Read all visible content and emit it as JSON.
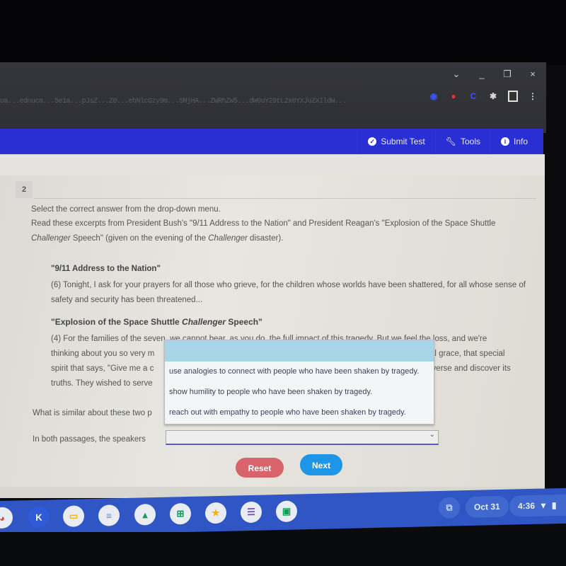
{
  "window": {
    "controls": {
      "dropdown": "⌄",
      "minimize": "_",
      "restore": "❐",
      "close": "×"
    },
    "address_bar_text": "ua...ednucm...5e1a...pJsZ...Z0...ehNlcGzy9m...SMjHA...ZWRhZW5...dW0uY29tL2x0YXJuZXIldW..."
  },
  "extensions": [
    {
      "name": "extension-blue-icon",
      "glyph": "◉"
    },
    {
      "name": "extension-red-icon",
      "glyph": "●"
    },
    {
      "name": "extension-c-icon",
      "glyph": "C"
    },
    {
      "name": "extensions-puzzle-icon",
      "glyph": "✱"
    },
    {
      "name": "side-panel-icon",
      "glyph": ""
    },
    {
      "name": "browser-menu-icon",
      "glyph": "⋮"
    }
  ],
  "toolbar": {
    "submit_label": "Submit Test",
    "tools_label": "Tools",
    "info_label": "Info"
  },
  "question": {
    "number": "2",
    "instruction": "Select the correct answer from the drop-down menu.",
    "intro_parts": [
      "Read these excerpts from President Bush's \"9/11 Address to the Nation\" and President Reagan's \"Explosion of the Space Shuttle ",
      "Challenger",
      " Speech\" (given on the evening of the ",
      "Challenger",
      " disaster)."
    ],
    "excerpt1_title": "\"9/11 Address to the Nation\"",
    "excerpt1_text": "(6) Tonight, I ask for your prayers for all those who grieve, for the children whose worlds have been shattered, for all whose sense of safety and security has been threatened...",
    "excerpt2_title_parts": [
      "\"Explosion of the Space Shuttle ",
      "Challenger",
      " Speech\""
    ],
    "excerpt2_lines": [
      "(4) For the families of the seven, we cannot bear, as you do, the full impact of this tragedy. But we feel the loss, and we're",
      "thinking about you so very m",
      "spirit that says, \"Give me a c",
      "truths. They wished to serve"
    ],
    "excerpt2_visible_right": [
      "al grace, that special",
      "iverse and discover its"
    ],
    "prompt": "What is similar about these two p",
    "answer_lead": "In both passages, the speakers",
    "dropdown": {
      "selected": "",
      "options": [
        "use analogies to connect with people who have been shaken by tragedy.",
        "show humility to people who have been shaken by tragedy.",
        "reach out with empathy to people who have been shaken by tragedy."
      ]
    },
    "reset_label": "Reset",
    "next_label": "Next"
  },
  "shelf": {
    "apps": [
      {
        "name": "chrome-icon",
        "glyph": "◕",
        "color": "#e84335"
      },
      {
        "name": "k-app-icon",
        "glyph": "K",
        "color": "#ffffff",
        "bg": "#2f5bd6"
      },
      {
        "name": "slides-icon",
        "glyph": "▭",
        "color": "#f4b400"
      },
      {
        "name": "docs-icon",
        "glyph": "≡",
        "color": "#4285f4"
      },
      {
        "name": "drive-icon",
        "glyph": "▲",
        "color": "#0f9d58"
      },
      {
        "name": "sheets-icon",
        "glyph": "⊞",
        "color": "#0f9d58"
      },
      {
        "name": "keep-icon",
        "glyph": "★",
        "color": "#f4b400"
      },
      {
        "name": "forms-icon",
        "glyph": "☰",
        "color": "#7248b9"
      },
      {
        "name": "classroom-icon",
        "glyph": "▣",
        "color": "#0f9d58"
      }
    ],
    "date": "Oct 31",
    "time": "4:36"
  }
}
